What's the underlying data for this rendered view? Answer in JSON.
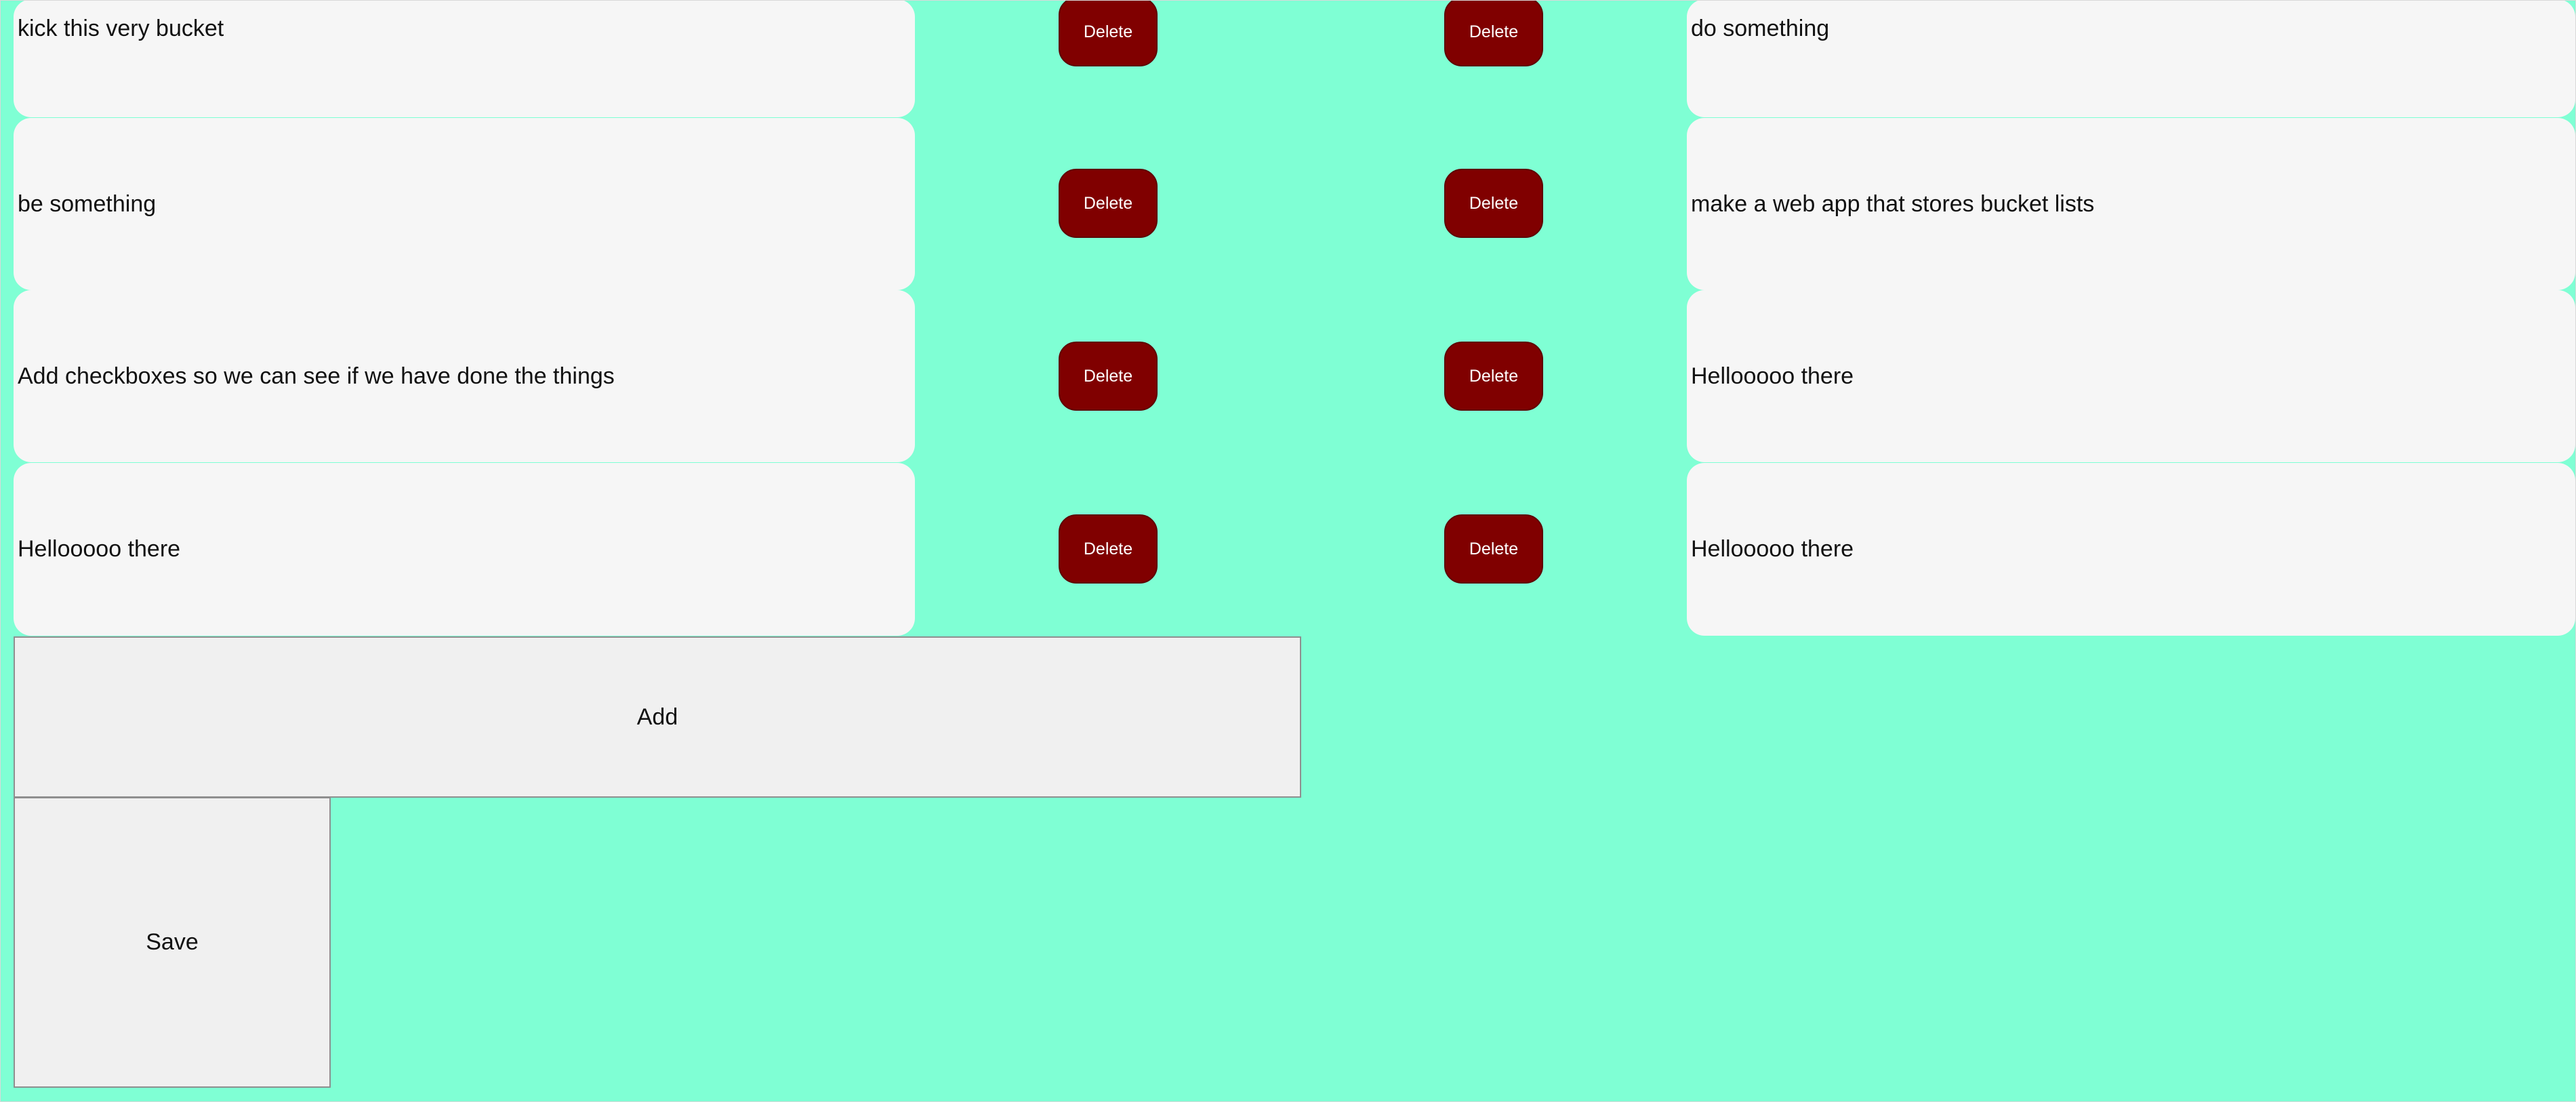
{
  "list": {
    "left_items": [
      "kick this very bucket",
      "be something",
      "Add checkboxes so we can see if we have done the things",
      "Hellooooo there"
    ],
    "right_items": [
      "do something",
      "make a web app that stores bucket lists",
      "Hellooooo there",
      "Hellooooo there"
    ],
    "delete_label": "Delete"
  },
  "actions": {
    "add_label": "Add",
    "save_label": "Save"
  },
  "colors": {
    "background": "#7fffd4",
    "item_background": "#f6f6f6",
    "delete_button": "#800000",
    "button_background": "#f0f0f0"
  }
}
